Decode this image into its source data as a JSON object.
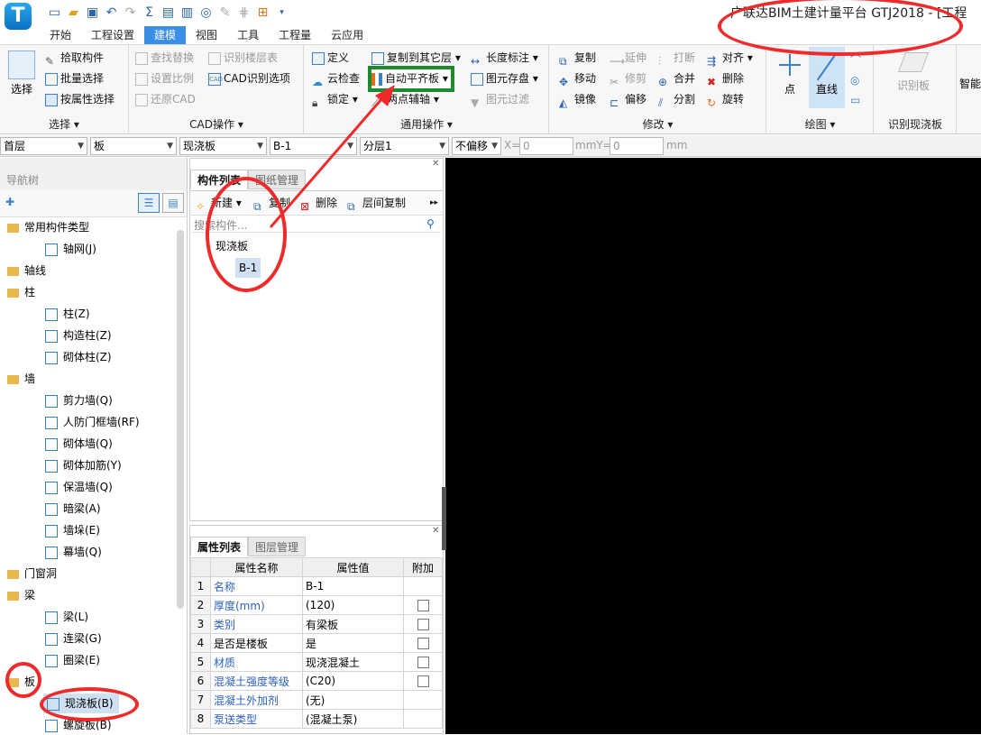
{
  "app": {
    "title": "广联达BIM土建计量平台 GTJ2018 - [工程",
    "logo_letter": "T"
  },
  "menu_tabs": [
    "开始",
    "工程设置",
    "建模",
    "视图",
    "工具",
    "工程量",
    "云应用"
  ],
  "ribbon": {
    "select": {
      "big_label": "选择",
      "items": [
        "拾取构件",
        "批量选择",
        "按属性选择"
      ],
      "title": "选择"
    },
    "cad": {
      "items": [
        "查找替换",
        "设置比例",
        "还原CAD",
        "识别楼层表",
        "CAD识别选项"
      ],
      "title": "CAD操作"
    },
    "common": {
      "items": [
        "定义",
        "云检查",
        "锁定",
        "复制到其它层",
        "自动平齐板",
        "两点辅轴",
        "长度标注",
        "图元存盘",
        "图元过滤"
      ],
      "title": "通用操作"
    },
    "modify": {
      "items": [
        "复制",
        "延伸",
        "打断",
        "对齐",
        "移动",
        "修剪",
        "合并",
        "删除",
        "镜像",
        "偏移",
        "分割",
        "旋转"
      ],
      "title": "修改"
    },
    "draw": {
      "items": [
        "点",
        "直线"
      ],
      "title": "绘图"
    },
    "recognize": {
      "big_label": "识别板",
      "title": "识别现浇板"
    },
    "smart": {
      "big_label": "智能"
    }
  },
  "selectors": {
    "floor": "首层",
    "category": "板",
    "type": "现浇板",
    "component": "B-1",
    "layer": "分层1",
    "offset": "不偏移",
    "x_label": "X=",
    "x_value": "0",
    "unit_x": "mmY=",
    "y_value": "0",
    "unit_y": "mm"
  },
  "nav": {
    "title": "导航树",
    "tree": [
      {
        "type": "folder",
        "label": "常用构件类型"
      },
      {
        "type": "item",
        "label": "轴网(J)"
      },
      {
        "type": "folder",
        "label": "轴线"
      },
      {
        "type": "folder",
        "label": "柱"
      },
      {
        "type": "item",
        "label": "柱(Z)"
      },
      {
        "type": "item",
        "label": "构造柱(Z)"
      },
      {
        "type": "item",
        "label": "砌体柱(Z)"
      },
      {
        "type": "folder",
        "label": "墙"
      },
      {
        "type": "item",
        "label": "剪力墙(Q)"
      },
      {
        "type": "item",
        "label": "人防门框墙(RF)"
      },
      {
        "type": "item",
        "label": "砌体墙(Q)"
      },
      {
        "type": "item",
        "label": "砌体加筋(Y)"
      },
      {
        "type": "item",
        "label": "保温墙(Q)"
      },
      {
        "type": "item",
        "label": "暗梁(A)"
      },
      {
        "type": "item",
        "label": "墙垛(E)"
      },
      {
        "type": "item",
        "label": "幕墙(Q)"
      },
      {
        "type": "folder",
        "label": "门窗洞"
      },
      {
        "type": "folder",
        "label": "梁"
      },
      {
        "type": "item",
        "label": "梁(L)"
      },
      {
        "type": "item",
        "label": "连梁(G)"
      },
      {
        "type": "item",
        "label": "圈梁(E)"
      },
      {
        "type": "folder",
        "label": "板"
      },
      {
        "type": "item",
        "label": "现浇板(B)",
        "selected": true
      },
      {
        "type": "item",
        "label": "螺旋板(B)"
      }
    ]
  },
  "component_list": {
    "tabs": [
      "构件列表",
      "图纸管理"
    ],
    "toolbar": [
      "新建",
      "复制",
      "删除",
      "层间复制"
    ],
    "search_placeholder": "搜索构件...",
    "tree": {
      "parent": "现浇板",
      "child": "B-1"
    }
  },
  "property_list": {
    "tabs": [
      "属性列表",
      "图层管理"
    ],
    "headers": [
      "属性名称",
      "属性值",
      "附加"
    ],
    "rows": [
      {
        "no": "1",
        "name": "名称",
        "value": "B-1",
        "blue": true,
        "check": false
      },
      {
        "no": "2",
        "name": "厚度(mm)",
        "value": "(120)",
        "blue": true,
        "check": true
      },
      {
        "no": "3",
        "name": "类别",
        "value": "有梁板",
        "blue": true,
        "check": true
      },
      {
        "no": "4",
        "name": "是否是楼板",
        "value": "是",
        "blue": false,
        "check": true
      },
      {
        "no": "5",
        "name": "材质",
        "value": "现浇混凝土",
        "blue": true,
        "check": true
      },
      {
        "no": "6",
        "name": "混凝土强度等级",
        "value": "(C20)",
        "blue": true,
        "check": true
      },
      {
        "no": "7",
        "name": "混凝土外加剂",
        "value": "(无)",
        "blue": true,
        "check": false
      },
      {
        "no": "8",
        "name": "泵送类型",
        "value": "(混凝土泵)",
        "blue": true,
        "check": false
      }
    ]
  },
  "colors": {
    "accent": "#3a8ee6",
    "annotation_red": "#f02a2a",
    "annotation_green": "#1e8a2e",
    "canvas": "#000000"
  }
}
